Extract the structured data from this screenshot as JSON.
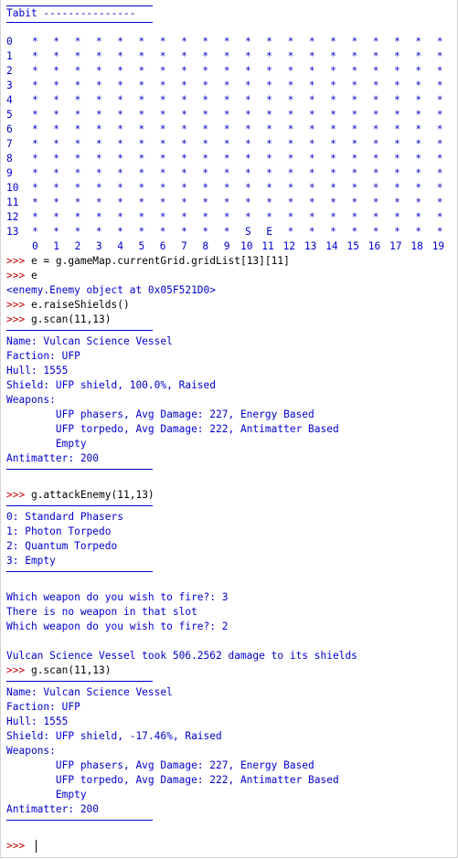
{
  "header_rule_lines": [
    "",
    ""
  ],
  "header_title": "Tabit ---------------",
  "grid": {
    "rows": [
      "0",
      "1",
      "2",
      "3",
      "4",
      "5",
      "6",
      "7",
      "8",
      "9",
      "10",
      "11",
      "12",
      "13"
    ],
    "cols": [
      "0",
      "1",
      "2",
      "3",
      "4",
      "5",
      "6",
      "7",
      "8",
      "9",
      "10",
      "11",
      "12",
      "13",
      "14",
      "15",
      "16",
      "17",
      "18",
      "19"
    ],
    "empty_cell": "*",
    "special_cells": [
      {
        "row": 13,
        "col": 10,
        "text": "S"
      },
      {
        "row": 13,
        "col": 11,
        "text": "E"
      }
    ]
  },
  "session": [
    {
      "kind": "cmd",
      "prompt": ">>>",
      "text": " e = g.gameMap.currentGrid.gridList[13][11]"
    },
    {
      "kind": "cmd",
      "prompt": ">>>",
      "text": " e"
    },
    {
      "kind": "out",
      "text": "<enemy.Enemy object at 0x05F521D0>"
    },
    {
      "kind": "cmd",
      "prompt": ">>>",
      "text": " e.raiseShields()"
    },
    {
      "kind": "cmd",
      "prompt": ">>>",
      "text": " g.scan(11,13)"
    },
    {
      "kind": "rule"
    },
    {
      "kind": "out",
      "text": "Name: Vulcan Science Vessel"
    },
    {
      "kind": "out",
      "text": "Faction: UFP"
    },
    {
      "kind": "out",
      "text": "Hull: 1555"
    },
    {
      "kind": "out",
      "text": "Shield: UFP shield, 100.0%, Raised"
    },
    {
      "kind": "out",
      "text": "Weapons:"
    },
    {
      "kind": "out",
      "text": "        UFP phasers, Avg Damage: 227, Energy Based"
    },
    {
      "kind": "out",
      "text": "        UFP torpedo, Avg Damage: 222, Antimatter Based"
    },
    {
      "kind": "out",
      "text": "        Empty"
    },
    {
      "kind": "out",
      "text": "Antimatter: 200"
    },
    {
      "kind": "rule"
    },
    {
      "kind": "blank"
    },
    {
      "kind": "cmd",
      "prompt": ">>>",
      "text": " g.attackEnemy(11,13)"
    },
    {
      "kind": "rule"
    },
    {
      "kind": "out",
      "text": "0: Standard Phasers"
    },
    {
      "kind": "out",
      "text": "1: Photon Torpedo"
    },
    {
      "kind": "out",
      "text": "2: Quantum Torpedo"
    },
    {
      "kind": "out",
      "text": "3: Empty"
    },
    {
      "kind": "rule"
    },
    {
      "kind": "blank"
    },
    {
      "kind": "out",
      "text": "Which weapon do you wish to fire?: 3"
    },
    {
      "kind": "out",
      "text": "There is no weapon in that slot"
    },
    {
      "kind": "out",
      "text": "Which weapon do you wish to fire?: 2"
    },
    {
      "kind": "blank"
    },
    {
      "kind": "out",
      "text": "Vulcan Science Vessel took 506.2562 damage to its shields"
    },
    {
      "kind": "cmd",
      "prompt": ">>>",
      "text": " g.scan(11,13)"
    },
    {
      "kind": "rule"
    },
    {
      "kind": "out",
      "text": "Name: Vulcan Science Vessel"
    },
    {
      "kind": "out",
      "text": "Faction: UFP"
    },
    {
      "kind": "out",
      "text": "Hull: 1555"
    },
    {
      "kind": "out",
      "text": "Shield: UFP shield, -17.46%, Raised"
    },
    {
      "kind": "out",
      "text": "Weapons:"
    },
    {
      "kind": "out",
      "text": "        UFP phasers, Avg Damage: 227, Energy Based"
    },
    {
      "kind": "out",
      "text": "        UFP torpedo, Avg Damage: 222, Antimatter Based"
    },
    {
      "kind": "out",
      "text": "        Empty"
    },
    {
      "kind": "out",
      "text": "Antimatter: 200"
    },
    {
      "kind": "rule"
    },
    {
      "kind": "blank"
    },
    {
      "kind": "cmd",
      "prompt": ">>>",
      "text": " ",
      "cursor": true
    }
  ],
  "colors": {
    "output": "#0000cc",
    "prompt": "#c40000",
    "input": "#000000"
  }
}
